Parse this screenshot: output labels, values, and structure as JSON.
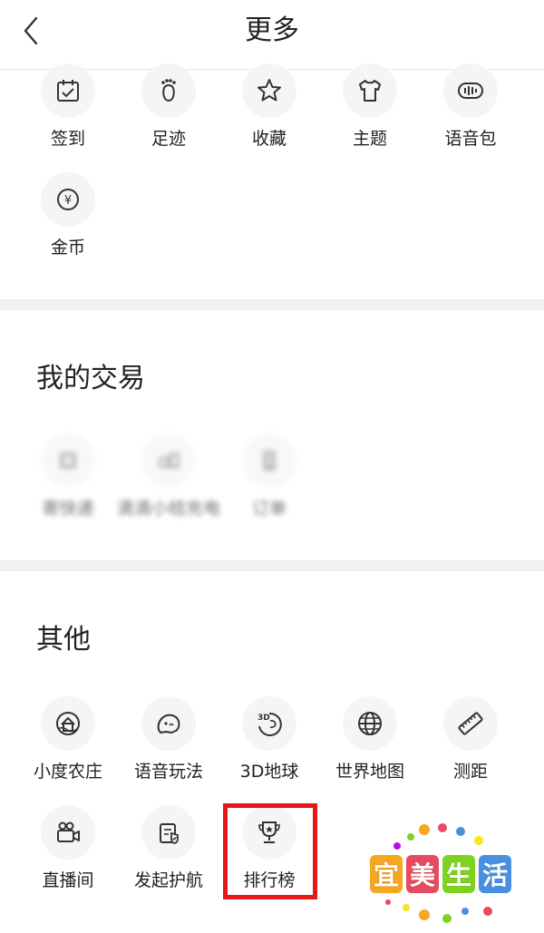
{
  "header": {
    "title": "更多"
  },
  "top_grid": [
    {
      "label": "签到",
      "icon": "calendar-check-icon"
    },
    {
      "label": "足迹",
      "icon": "footprint-icon"
    },
    {
      "label": "收藏",
      "icon": "star-icon"
    },
    {
      "label": "主题",
      "icon": "tshirt-icon"
    },
    {
      "label": "语音包",
      "icon": "voice-wave-icon"
    },
    {
      "label": "金币",
      "icon": "coin-icon"
    }
  ],
  "trade": {
    "title": "我的交易",
    "items": [
      {
        "label": "寄快递",
        "icon": "blurred-icon"
      },
      {
        "label": "滴滴小桔充电",
        "icon": "blurred-icon"
      },
      {
        "label": "订单",
        "icon": "blurred-icon"
      }
    ]
  },
  "other": {
    "title": "其他",
    "items": [
      {
        "label": "小度农庄",
        "icon": "farm-house-icon"
      },
      {
        "label": "语音玩法",
        "icon": "voice-play-icon"
      },
      {
        "label": "3D地球",
        "icon": "earth-3d-icon"
      },
      {
        "label": "世界地图",
        "icon": "globe-icon"
      },
      {
        "label": "测距",
        "icon": "ruler-icon"
      },
      {
        "label": "直播间",
        "icon": "live-camera-icon"
      },
      {
        "label": "发起护航",
        "icon": "escort-icon"
      },
      {
        "label": "排行榜",
        "icon": "trophy-icon"
      }
    ]
  },
  "watermark": {
    "chars": [
      "宜",
      "美",
      "生",
      "活"
    ]
  },
  "colors": {
    "highlight": "#e51717",
    "separator": "#eff1f3",
    "icon_bg": "#f4f5f6"
  }
}
